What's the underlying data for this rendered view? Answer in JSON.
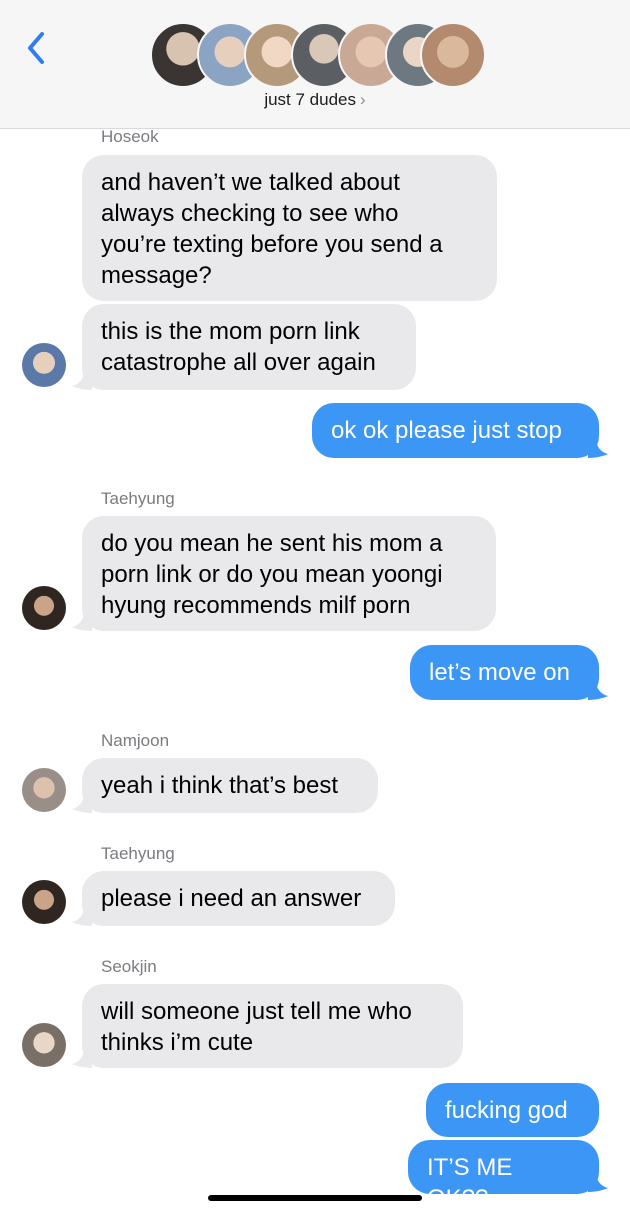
{
  "header": {
    "group_name": "just 7 dudes",
    "chevron": "›",
    "back_icon": "chevron-left-icon",
    "accent": "#2f7cf6",
    "avatar_colors": [
      "#3a3532",
      "#8ba4c4",
      "#b49a7a",
      "#5b5f63",
      "#c9a995",
      "#6e7880",
      "#b38a6e"
    ]
  },
  "messages": [
    {
      "sender": "Hoseok"
    },
    {
      "lines": [
        "and haven’t we talked about",
        "always checking to see who",
        "you’re texting before you send a",
        "message?"
      ]
    },
    {
      "lines": [
        "this is the mom porn link",
        "catastrophe all over again"
      ]
    },
    {
      "lines": [
        "ok ok please just stop"
      ]
    },
    {
      "sender": "Taehyung"
    },
    {
      "lines": [
        "do you mean he sent his mom a",
        "porn link or do you mean yoongi",
        "hyung recommends milf porn"
      ]
    },
    {
      "lines": [
        "let’s move on"
      ]
    },
    {
      "sender": "Namjoon"
    },
    {
      "lines": [
        "yeah i think that’s best"
      ]
    },
    {
      "sender": "Taehyung"
    },
    {
      "lines": [
        "please i need an answer"
      ]
    },
    {
      "sender": "Seokjin"
    },
    {
      "lines": [
        "will someone just tell me who",
        "thinks i’m cute"
      ]
    },
    {
      "lines": [
        "fucking god"
      ]
    },
    {
      "lines": [
        "IT’S ME OK??"
      ]
    }
  ],
  "colors": {
    "incoming_bubble": "#e9e9eb",
    "outgoing_bubble": "#3b96f5",
    "sender_label": "#7b7b80"
  }
}
